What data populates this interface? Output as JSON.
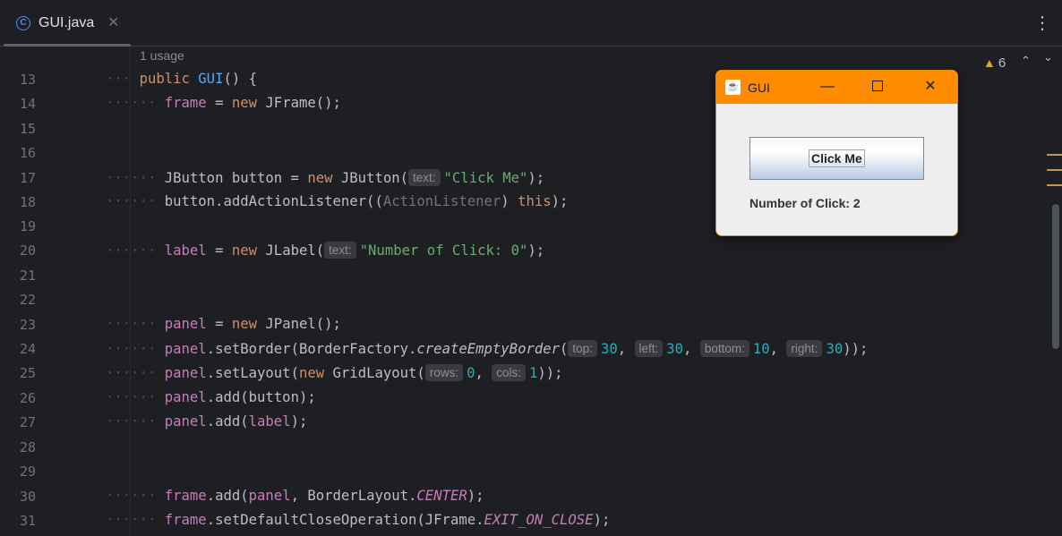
{
  "tab": {
    "label": "GUI.java",
    "icon": "java-class-icon",
    "icon_glyph": "C",
    "close": "✕"
  },
  "more_glyph": "⋮",
  "editor": {
    "usage_hint": "1 usage",
    "line_numbers": [
      "13",
      "14",
      "15",
      "16",
      "17",
      "18",
      "19",
      "20",
      "21",
      "22",
      "23",
      "24",
      "25",
      "26",
      "27",
      "28",
      "29",
      "30",
      "31"
    ],
    "lines": {
      "l13": {
        "dots": "···",
        "kw": "public",
        "fn": "GUI",
        "rest": "() {"
      },
      "l14": {
        "dots": "······",
        "field": "frame",
        "eq": " = ",
        "kw": "new",
        "rest": " JFrame();"
      },
      "l17": {
        "dots": "······",
        "pre": "JButton button = ",
        "kw": "new",
        "mid": " JButton(",
        "hint": "text:",
        "str": "\"Click Me\"",
        "end": ");"
      },
      "l18": {
        "dots": "······",
        "pre": "button.addActionListener((",
        "cast": "ActionListener",
        "mid": ") ",
        "kw": "this",
        "end": ");"
      },
      "l20": {
        "dots": "······",
        "field": "label",
        "eq": " = ",
        "kw": "new",
        "mid": " JLabel(",
        "hint": "text:",
        "str": "\"Number of Click: 0\"",
        "end": ");"
      },
      "l23": {
        "dots": "······",
        "field": "panel",
        "eq": " = ",
        "kw": "new",
        "rest": " JPanel();"
      },
      "l24": {
        "dots": "······",
        "field": "panel",
        "pre": ".setBorder(BorderFactory.",
        "ital": "createEmptyBorder",
        "open": "(",
        "h1": "top:",
        "n1": "30",
        "c1": ", ",
        "h2": "left:",
        "n2": "30",
        "c2": ", ",
        "h3": "bottom:",
        "n3": "10",
        "c3": ", ",
        "h4": "right:",
        "n4": "30",
        "end": "));"
      },
      "l25": {
        "dots": "······",
        "field": "panel",
        "pre": ".setLayout(",
        "kw": "new",
        "mid": " GridLayout(",
        "h1": "rows:",
        "n1": "0",
        "c1": ", ",
        "h2": "cols:",
        "n2": "1",
        "end": "));"
      },
      "l26": {
        "dots": "······",
        "field": "panel",
        "pre": ".add(button);"
      },
      "l27": {
        "dots": "······",
        "field": "panel",
        "pre": ".add(",
        "field2": "label",
        "end": ");"
      },
      "l30": {
        "dots": "······",
        "field": "frame",
        "pre": ".add(",
        "field2": "panel",
        "mid": ", BorderLayout.",
        "const": "CENTER",
        "end": ");"
      },
      "l31": {
        "dots": "······",
        "field": "frame",
        "pre": ".setDefaultCloseOperation(JFrame.",
        "const": "EXIT_ON_CLOSE",
        "end": ");"
      }
    }
  },
  "inspections": {
    "icon": "warning-icon",
    "glyph": "▲",
    "count": "6",
    "up": "⌃",
    "down": "⌄"
  },
  "swing_window": {
    "title": "GUI",
    "icon": "java-cup-icon",
    "icon_glyph": "☕",
    "minimize": "—",
    "close": "✕",
    "button_label": "Click Me",
    "label_text": "Number of Click: 2",
    "title_color": "#ff8c00"
  }
}
